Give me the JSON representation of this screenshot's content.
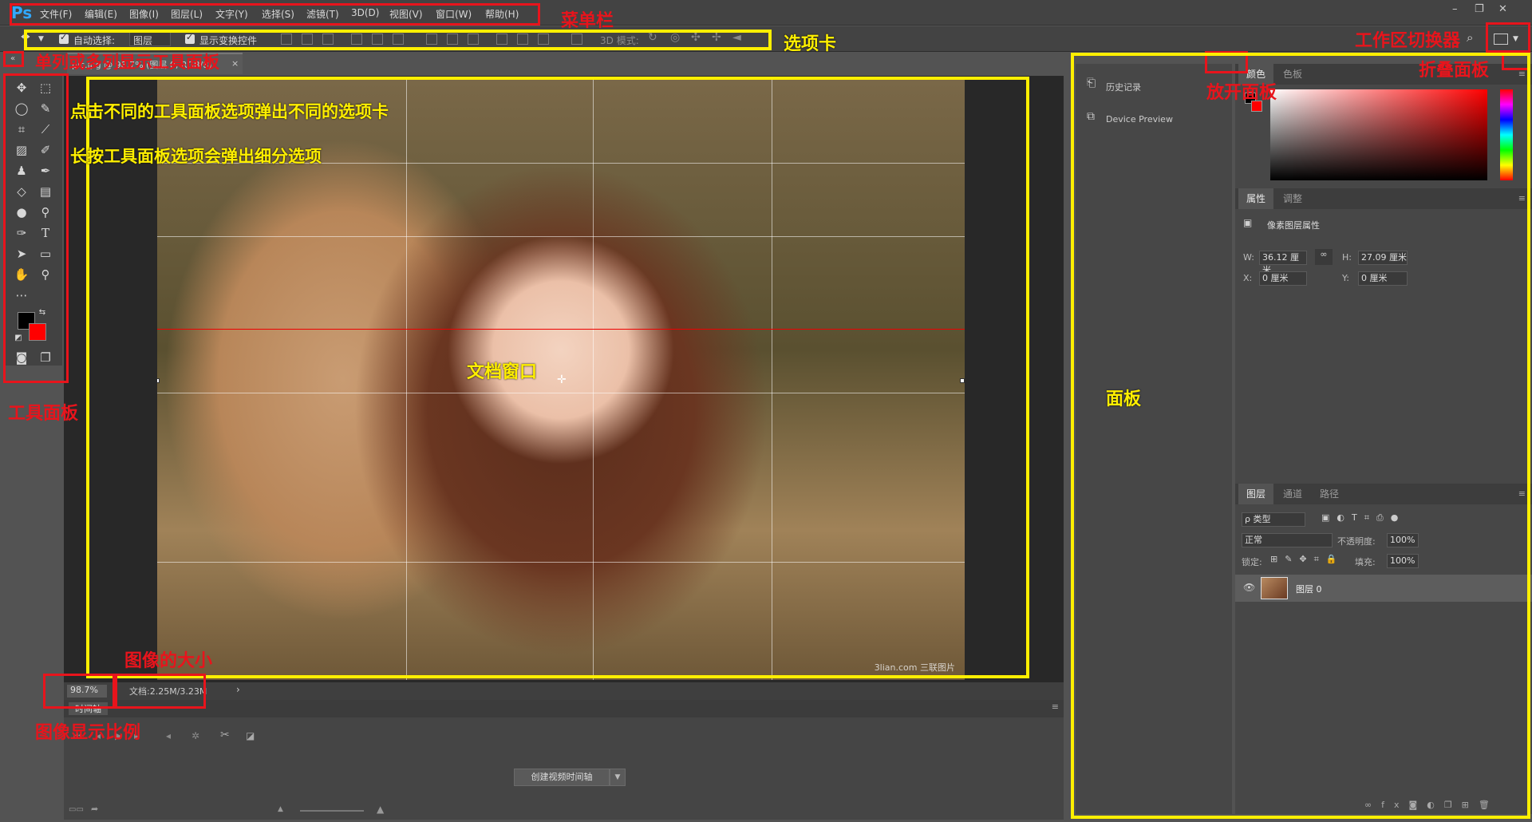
{
  "menu": {
    "logo": "Ps",
    "items": [
      "文件(F)",
      "编辑(E)",
      "图像(I)",
      "图层(L)",
      "文字(Y)",
      "选择(S)",
      "滤镜(T)",
      "3D(D)",
      "视图(V)",
      "窗口(W)",
      "帮助(H)"
    ],
    "window_buttons": [
      "–",
      "❐",
      "✕"
    ]
  },
  "options": {
    "auto_select_label": "自动选择:",
    "auto_select_value": "图层",
    "show_transform_label": "显示变换控件",
    "mode_3d_label": "3D 模式:"
  },
  "doc": {
    "tab_label": "pic.jpg @ 98.7% (图层 0, RGB/8)",
    "watermark": "3lian.com 三联图片",
    "zoom": "98.7%",
    "doc_size": "文档:2.25M/3.23M",
    "arrow": "›"
  },
  "timeline": {
    "tab_label": "时间轴",
    "create_button": "创建视频时间轴"
  },
  "dock": {
    "history_label": "历史记录",
    "device_preview_label": "Device Preview"
  },
  "color_panel": {
    "tab_color": "颜色",
    "tab_swatches": "色板",
    "foreground": "#000000",
    "background": "#ff0000"
  },
  "properties": {
    "tab_properties": "属性",
    "tab_adjust": "调整",
    "title": "像素图层属性",
    "w_label": "W:",
    "w_value": "36.12 厘米",
    "h_label": "H:",
    "h_value": "27.09 厘米",
    "x_label": "X:",
    "x_value": "0 厘米",
    "y_label": "Y:",
    "y_value": "0 厘米"
  },
  "layers": {
    "tab_layers": "图层",
    "tab_channels": "通道",
    "tab_paths": "路径",
    "filter_kind": "ρ 类型",
    "blend_mode": "正常",
    "opacity_label": "不透明度:",
    "opacity_value": "100%",
    "lock_label": "锁定:",
    "fill_label": "填充:",
    "fill_value": "100%",
    "layer_name": "图层 0"
  },
  "annotations": {
    "menubar": "菜单栏",
    "optionsbar": "选项卡",
    "workspace_switcher": "工作区切换器",
    "single_double_toggle": "单列或多列显示工具面板",
    "expand_panel": "放开面板",
    "collapse_panel": "折叠面板",
    "click_tip": "点击不同的工具面板选项弹出不同的选项卡",
    "longpress_tip": "长按工具面板选项会弹出细分选项",
    "document_window": "文档窗口",
    "tool_panel": "工具面板",
    "panel": "面板",
    "image_size": "图像的大小",
    "zoom_ratio": "图像显示比例"
  }
}
